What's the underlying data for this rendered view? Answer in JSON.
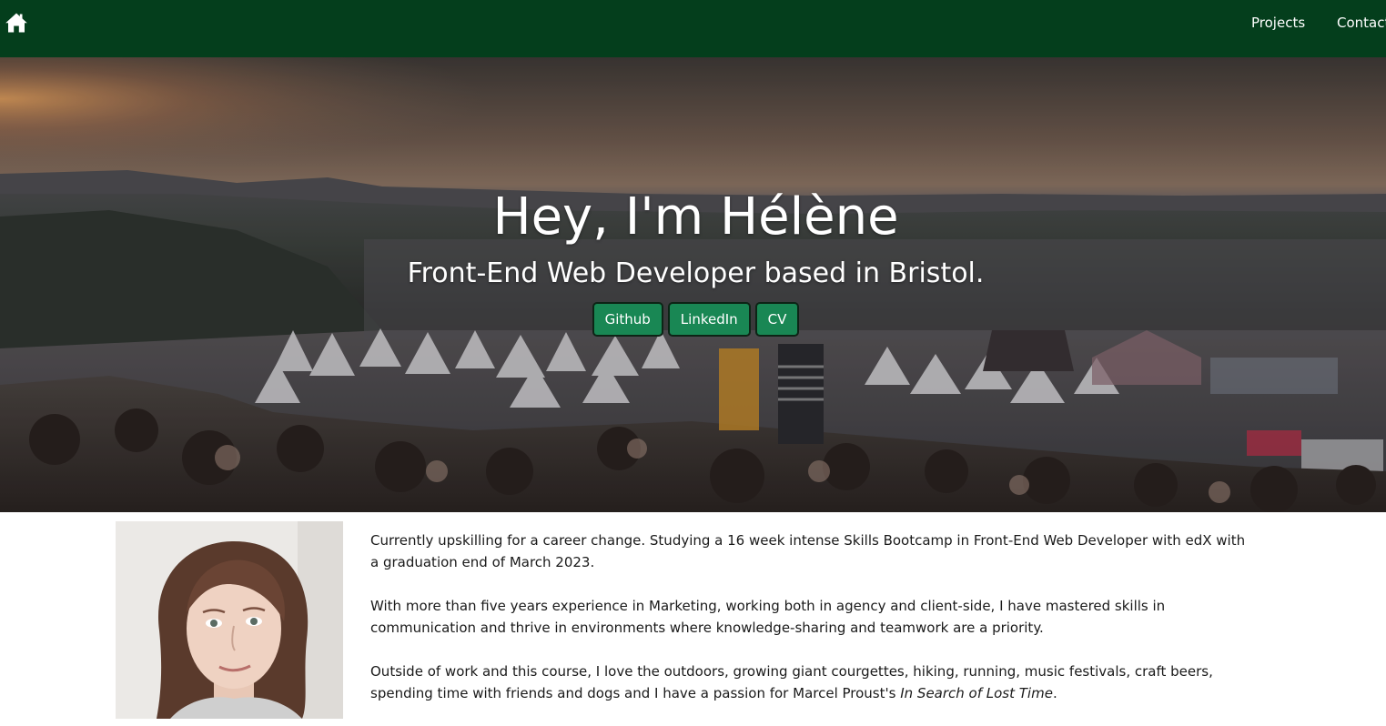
{
  "nav": {
    "home_icon": "home-icon",
    "links": [
      {
        "label": "Projects"
      },
      {
        "label": "Contact"
      }
    ]
  },
  "hero": {
    "title": "Hey, I'm Hélène",
    "subtitle": "Front-End Web Developer based in Bristol.",
    "buttons": [
      {
        "label": "Github"
      },
      {
        "label": "LinkedIn"
      },
      {
        "label": "CV"
      }
    ]
  },
  "about": {
    "paragraph_1": "Currently upskilling for a career change. Studying a 16 week intense Skills Bootcamp in Front-End Web Developer with edX with a graduation end of March 2023.",
    "paragraph_2": "With more than five years experience in Marketing, working both in agency and client-side, I have mastered skills in communication and thrive in environments where knowledge-sharing and teamwork are a priority.",
    "paragraph_3_start": "Outside of work and this course, I love the outdoors, growing giant courgettes, hiking, running, music festivals, craft beers, spending time with friends and dogs and I have a passion for Marcel Proust's ",
    "paragraph_3_book": "In Search of Lost Time",
    "paragraph_3_end": "."
  },
  "colors": {
    "navbar": "#043e1c",
    "button": "#198754",
    "text": "#1a1a1a"
  }
}
